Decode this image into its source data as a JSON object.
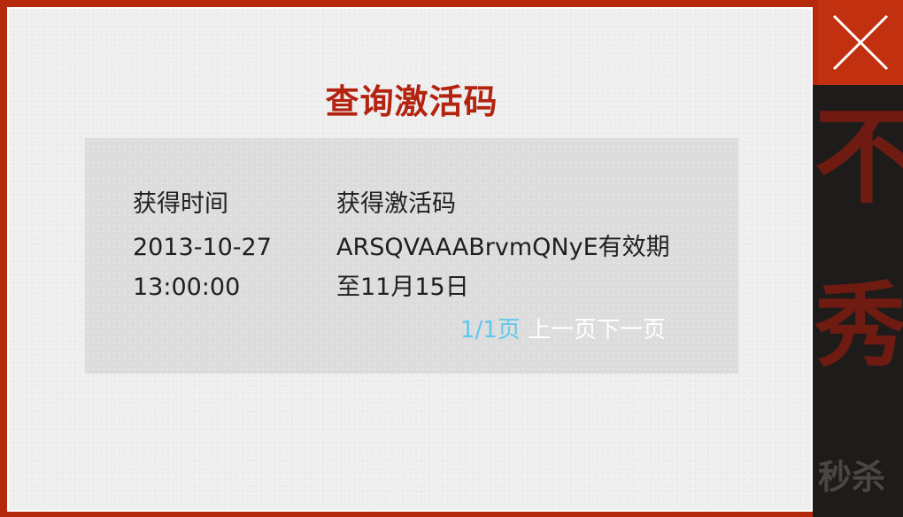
{
  "dialog": {
    "title": "查询激活码"
  },
  "table": {
    "headers": [
      "获得时间",
      "获得激活码"
    ],
    "rows": [
      {
        "time": "2013-10-27 13:00:00",
        "code": "ARSQVAAABrvmQNyE有效期至11月15日"
      }
    ]
  },
  "pagination": {
    "indicator": "1/1页",
    "prev_label": "上一页",
    "next_label": "下一页"
  },
  "background": {
    "promo_chars": [
      "不",
      "秀",
      "秒杀"
    ]
  },
  "colors": {
    "accent_red": "#b3230f",
    "frame_red": "#b52a0d",
    "pager_blue": "#5ec7ee"
  },
  "icons": {
    "close": "close-x-icon"
  }
}
